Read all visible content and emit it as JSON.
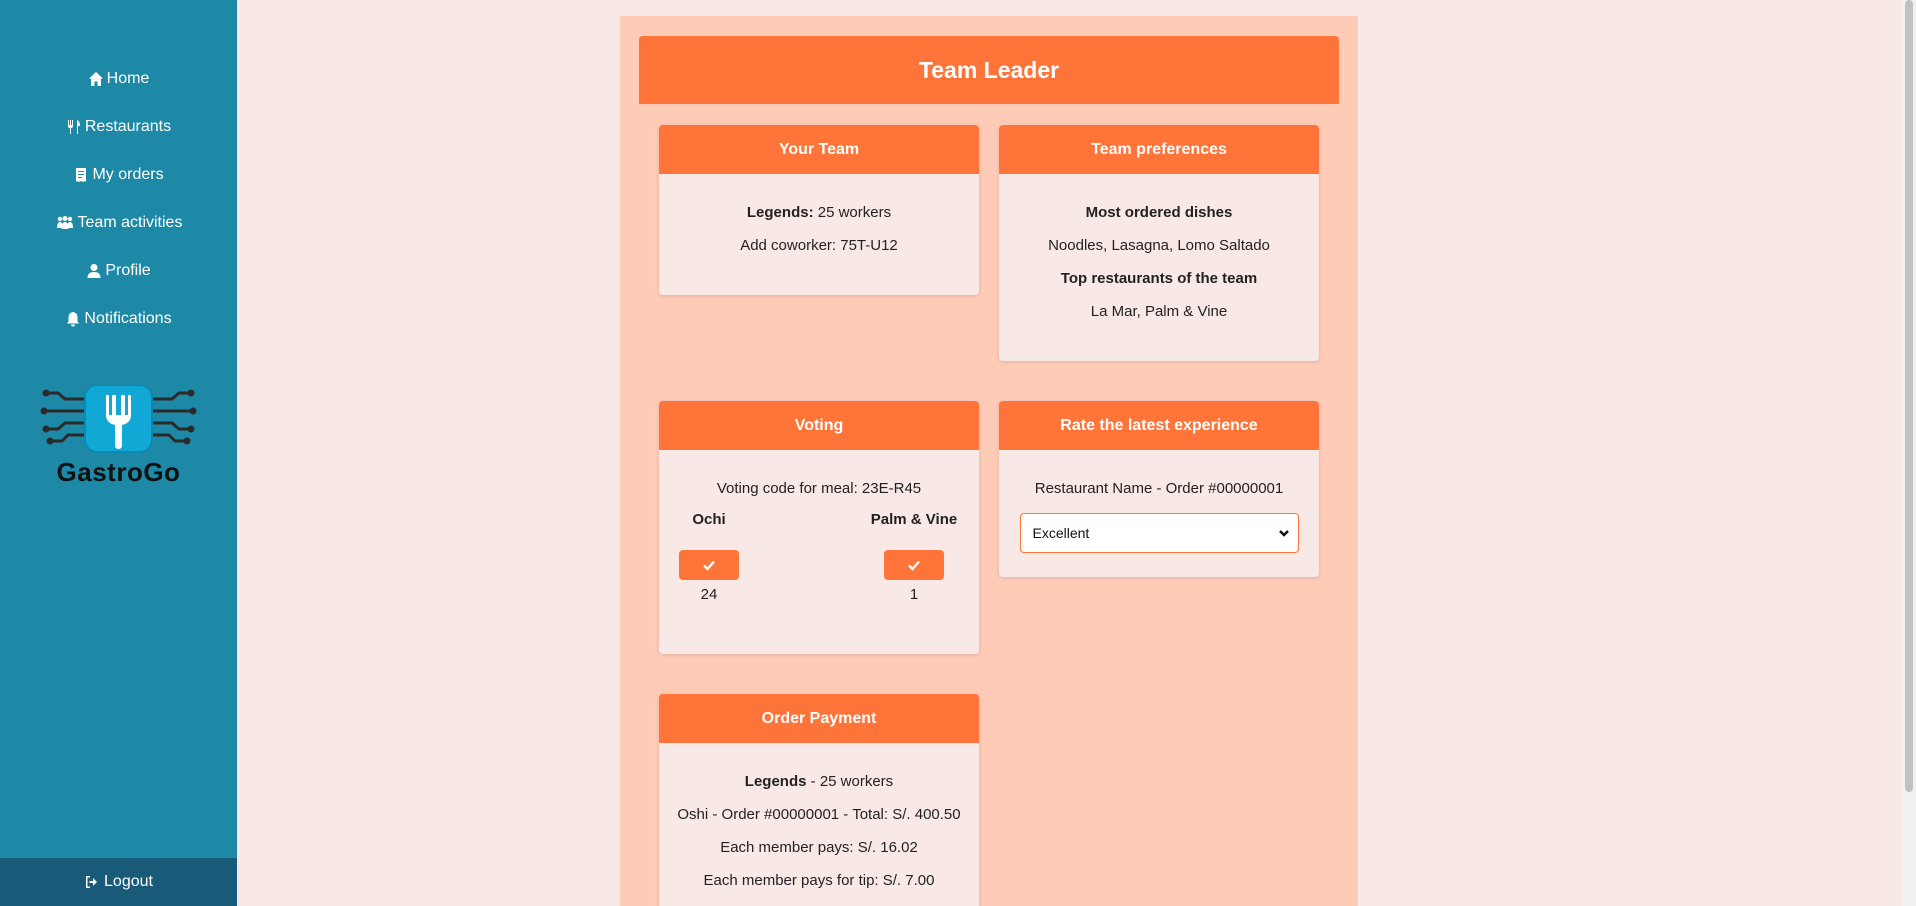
{
  "sidebar": {
    "items": [
      {
        "label": "Home",
        "icon": "home-icon"
      },
      {
        "label": "Restaurants",
        "icon": "utensils-icon"
      },
      {
        "label": "My orders",
        "icon": "receipt-icon"
      },
      {
        "label": "Team activities",
        "icon": "people-icon"
      },
      {
        "label": "Profile",
        "icon": "user-icon"
      },
      {
        "label": "Notifications",
        "icon": "bell-icon"
      }
    ],
    "logo_text": "GastroGo",
    "logout_label": "Logout"
  },
  "page": {
    "title": "Team Leader"
  },
  "your_team": {
    "header": "Your Team",
    "team_name": "Legends:",
    "team_size": " 25 workers",
    "add_coworker": "Add coworker: 75T-U12"
  },
  "preferences": {
    "header": "Team preferences",
    "dishes_title": "Most ordered dishes",
    "dishes": "Noodles, Lasagna, Lomo Saltado",
    "restaurants_title": "Top restaurants of the team",
    "restaurants": "La Mar, Palm & Vine"
  },
  "voting": {
    "header": "Voting",
    "code": "Voting code for meal: 23E-R45",
    "options": [
      {
        "name": "Ochi",
        "votes": "24"
      },
      {
        "name": "Palm & Vine",
        "votes": "1"
      }
    ]
  },
  "rating": {
    "header": "Rate the latest experience",
    "order": "Restaurant Name - Order #00000001",
    "selected": "Excellent"
  },
  "payment": {
    "header": "Order Payment",
    "team_name": "Legends",
    "team_size": " - 25 workers",
    "order_line": "Oshi - Order #00000001 - Total: S/. 400.50",
    "each_pays": "Each member pays: S/. 16.02",
    "tip": "Each member pays for tip: S/. 7.00"
  },
  "colors": {
    "sidebar": "#1d89a6",
    "accent": "#ff7439",
    "panel": "#fecbb7",
    "card": "#f9e9e6"
  }
}
